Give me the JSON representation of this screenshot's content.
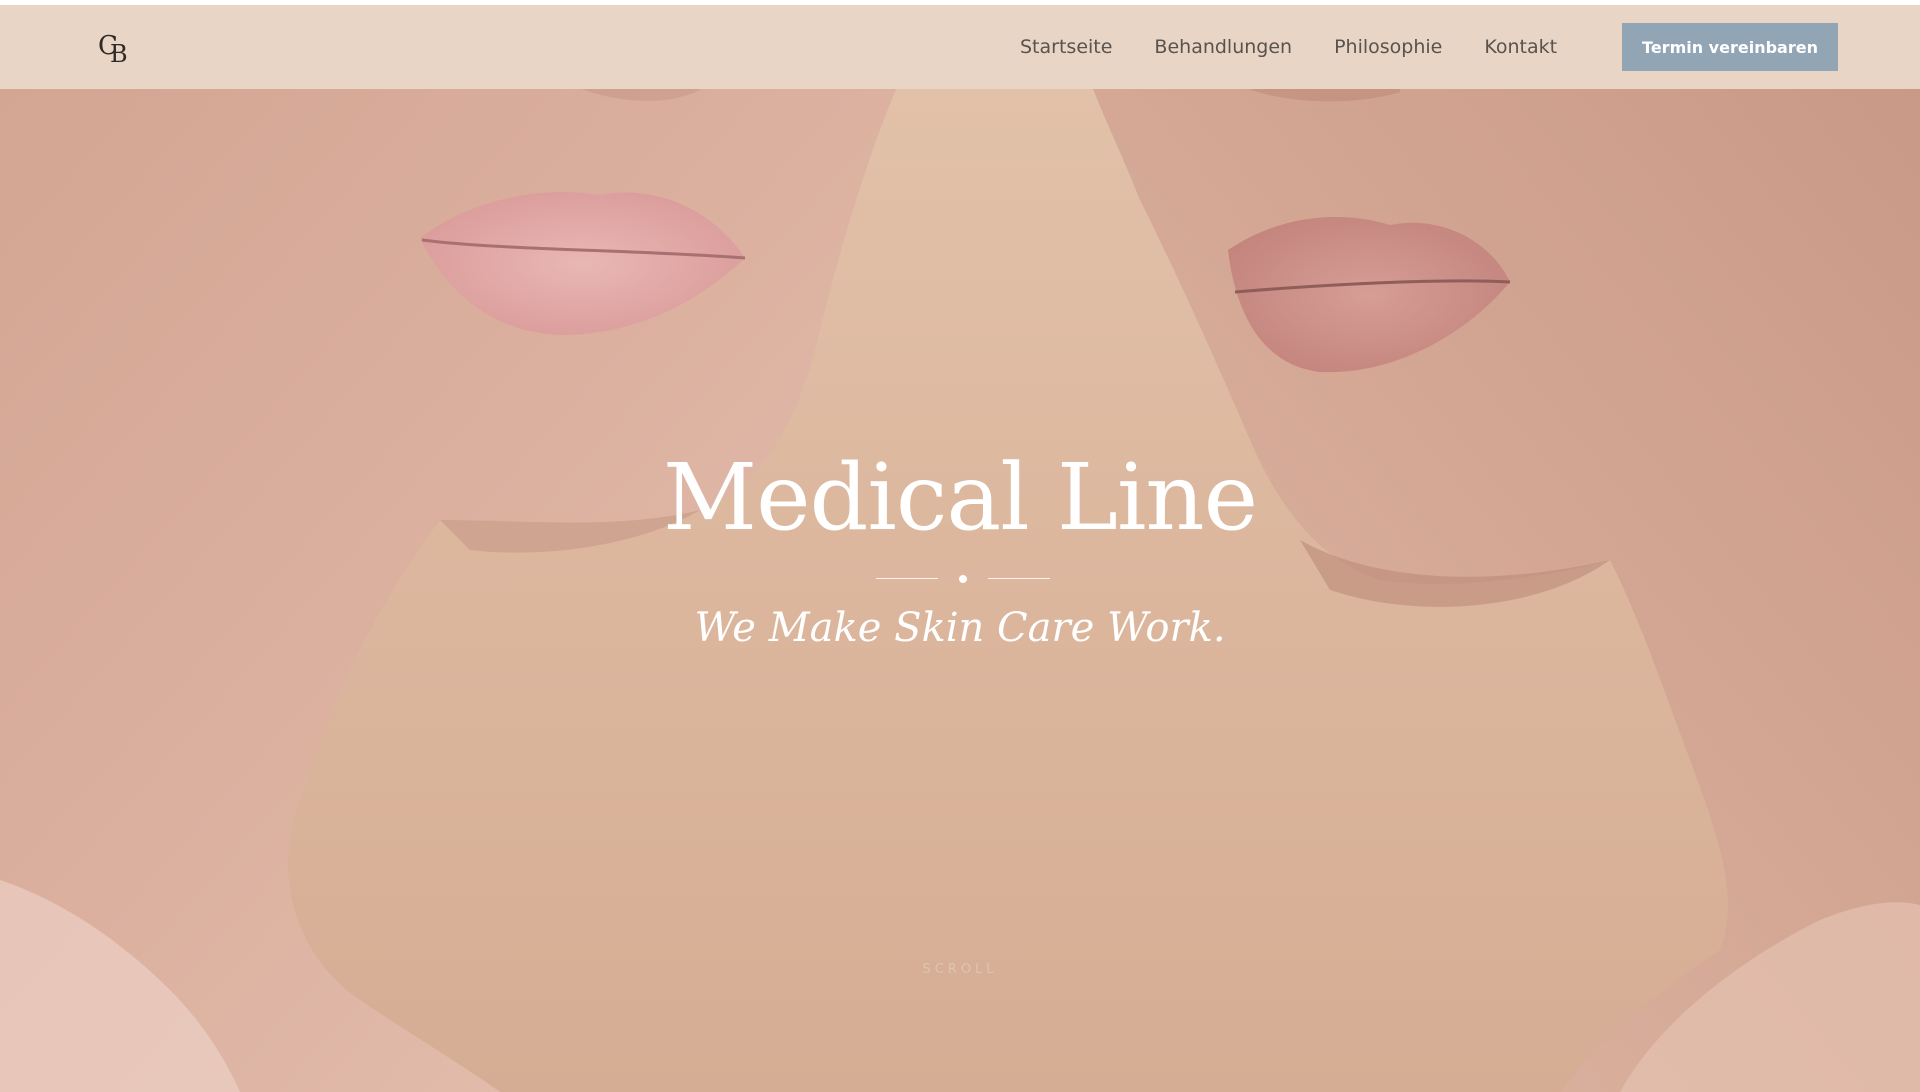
{
  "header": {
    "logo_text_1": "C",
    "logo_text_2": "B",
    "nav": [
      {
        "label": "Startseite"
      },
      {
        "label": "Behandlungen"
      },
      {
        "label": "Philosophie"
      },
      {
        "label": "Kontakt"
      }
    ],
    "cta_label": "Termin vereinbaren"
  },
  "hero": {
    "title": "Medical Line",
    "subtitle": "We Make Skin Care Work.",
    "scroll_label": "SCROLL"
  },
  "colors": {
    "header_bg": "#e8d5c6",
    "cta_bg": "#91a5b5",
    "hero_bg": "#d9b69e",
    "text_white": "#ffffff",
    "nav_text": "#5a524d"
  },
  "icons": {
    "logo": "cb-monogram-logo"
  }
}
